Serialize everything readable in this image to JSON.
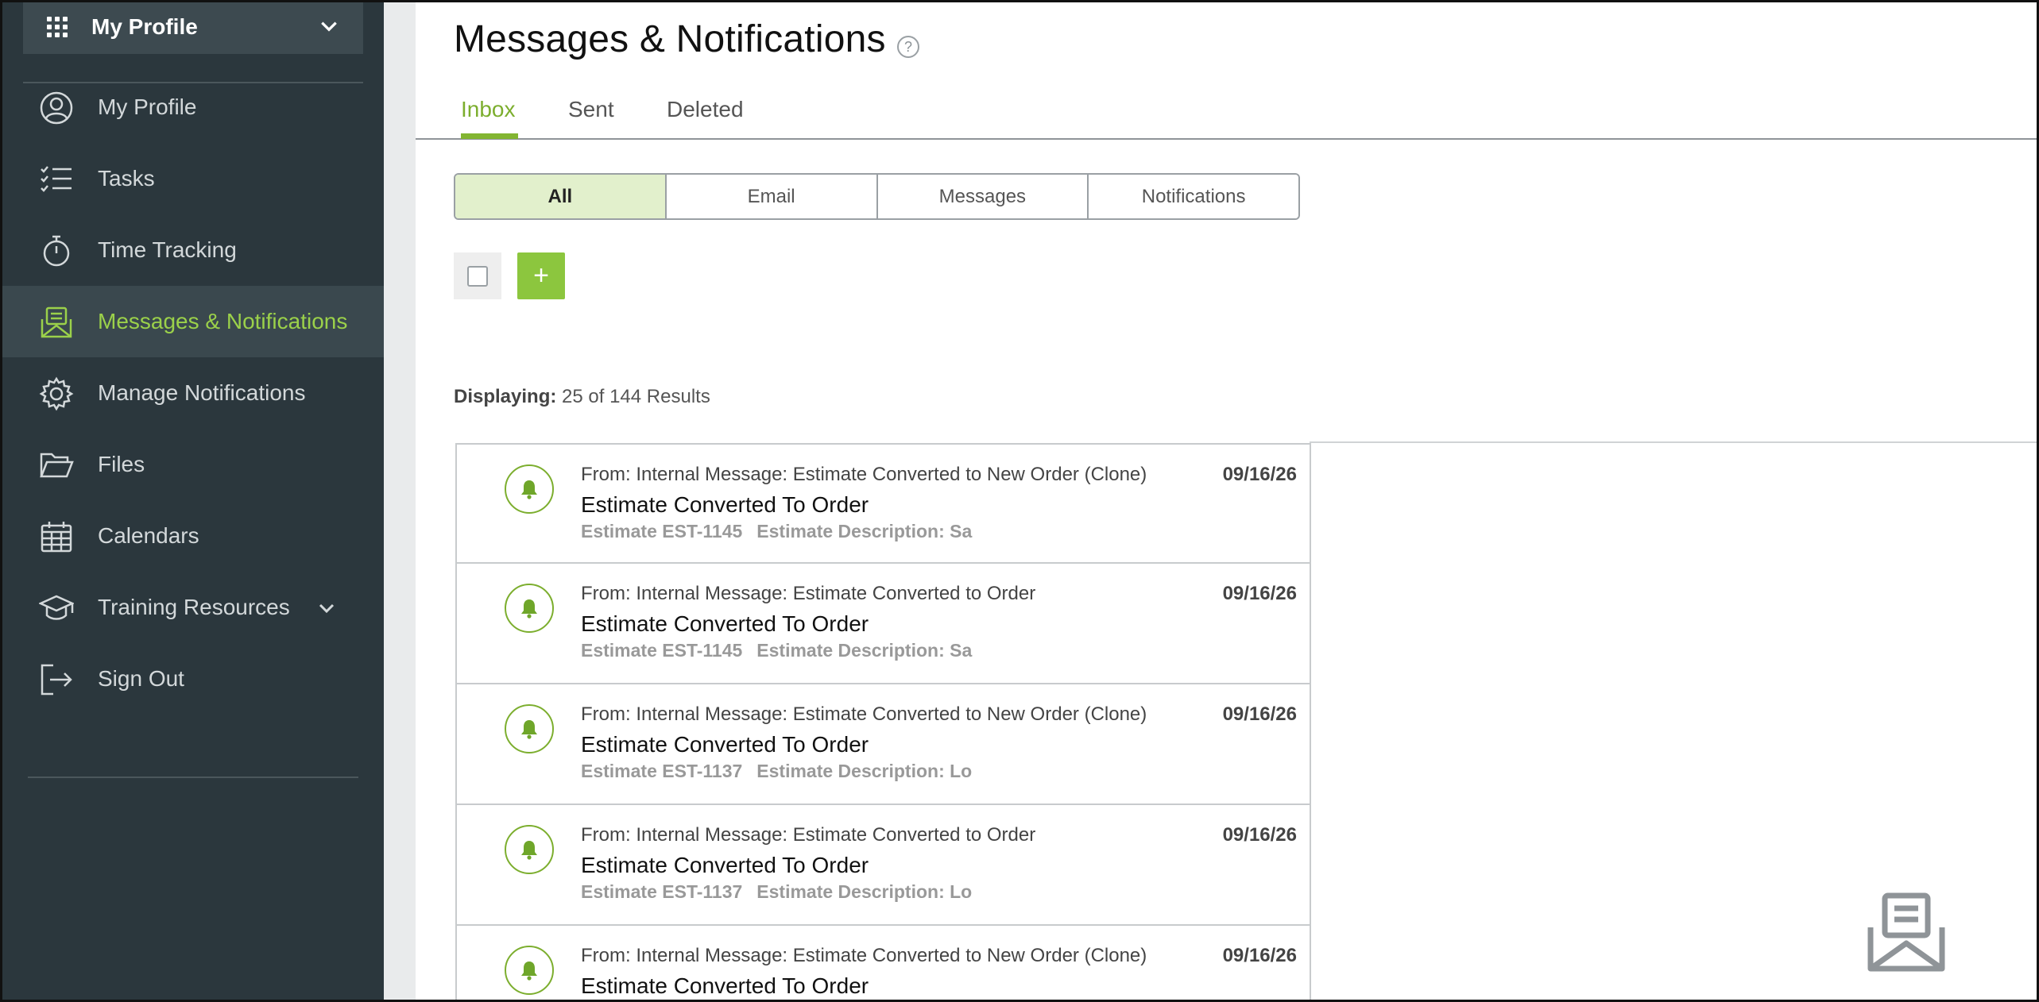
{
  "sidebar": {
    "profile_switcher": {
      "label": "My Profile"
    },
    "items": [
      {
        "label": "My Profile",
        "icon": "user-circle-icon",
        "active": false
      },
      {
        "label": "Tasks",
        "icon": "checklist-icon",
        "active": false
      },
      {
        "label": "Time Tracking",
        "icon": "stopwatch-icon",
        "active": false
      },
      {
        "label": "Messages & Notifications",
        "icon": "envelope-open-icon",
        "active": true
      },
      {
        "label": "Manage Notifications",
        "icon": "gear-icon",
        "active": false
      },
      {
        "label": "Files",
        "icon": "folder-open-icon",
        "active": false
      },
      {
        "label": "Calendars",
        "icon": "calendar-icon",
        "active": false
      },
      {
        "label": "Training Resources",
        "icon": "graduation-cap-icon",
        "active": false,
        "expandable": true
      },
      {
        "label": "Sign Out",
        "icon": "sign-out-icon",
        "active": false
      }
    ]
  },
  "main": {
    "title": "Messages & Notifications",
    "help_glyph": "?",
    "tabs": [
      {
        "label": "Inbox",
        "active": true
      },
      {
        "label": "Sent",
        "active": false
      },
      {
        "label": "Deleted",
        "active": false
      }
    ],
    "filters": [
      {
        "label": "All",
        "active": true
      },
      {
        "label": "Email",
        "active": false
      },
      {
        "label": "Messages",
        "active": false
      },
      {
        "label": "Notifications",
        "active": false
      }
    ],
    "add_button_glyph": "+",
    "displaying": {
      "label": "Displaying:",
      "value": "25 of 144 Results"
    },
    "messages": [
      {
        "from": "From: Internal Message: Estimate Converted to New Order (Clone)",
        "date": "09/16/26",
        "subject": "Estimate Converted To Order",
        "estimate": "Estimate EST-1145",
        "description": "Estimate Description: Sa"
      },
      {
        "from": "From: Internal Message: Estimate Converted to Order",
        "date": "09/16/26",
        "subject": "Estimate Converted To Order",
        "estimate": "Estimate EST-1145",
        "description": "Estimate Description: Sa"
      },
      {
        "from": "From: Internal Message: Estimate Converted to New Order (Clone)",
        "date": "09/16/26",
        "subject": "Estimate Converted To Order",
        "estimate": "Estimate EST-1137",
        "description": "Estimate Description: Lo"
      },
      {
        "from": "From: Internal Message: Estimate Converted to Order",
        "date": "09/16/26",
        "subject": "Estimate Converted To Order",
        "estimate": "Estimate EST-1137",
        "description": "Estimate Description: Lo"
      },
      {
        "from": "From: Internal Message: Estimate Converted to New Order (Clone)",
        "date": "09/16/26",
        "subject": "Estimate Converted To Order",
        "estimate": "",
        "description": ""
      }
    ]
  },
  "colors": {
    "sidebar_bg": "#2b373d",
    "accent_green": "#8cc63e",
    "active_nav_text": "#9bd14a",
    "active_filter_bg": "#e2f0cc"
  }
}
